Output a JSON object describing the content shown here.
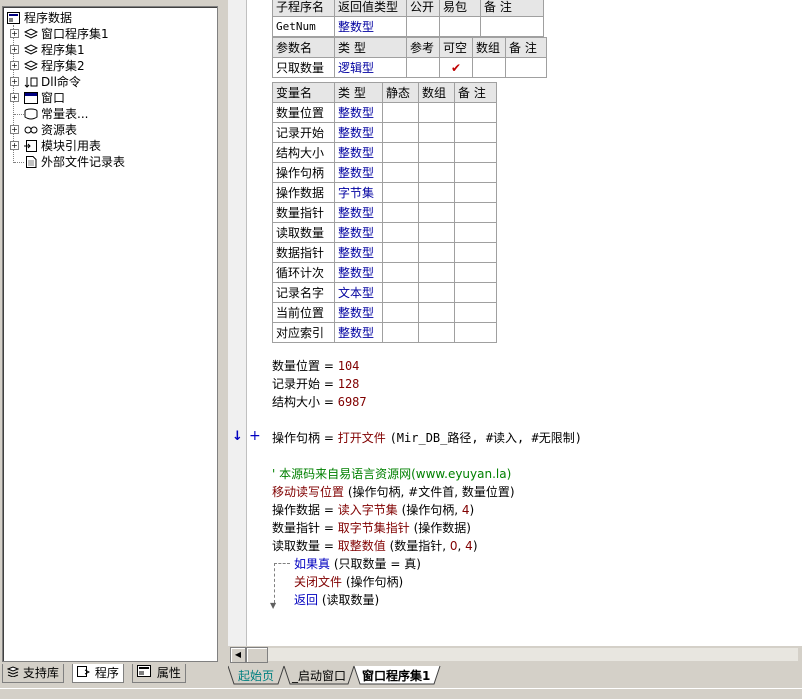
{
  "tree": {
    "root_label": "程序数据",
    "items": [
      {
        "label": "窗口程序集1",
        "icon": "module-icon",
        "expand": "+"
      },
      {
        "label": "程序集1",
        "icon": "module-icon",
        "expand": "+"
      },
      {
        "label": "程序集2",
        "icon": "module-icon",
        "expand": "+"
      },
      {
        "label": "Dll命令",
        "icon": "dll-icon",
        "expand": "+"
      },
      {
        "label": "窗口",
        "icon": "window-icon",
        "expand": "+"
      },
      {
        "label": "常量表...",
        "icon": "constant-icon",
        "expand": ""
      },
      {
        "label": "资源表",
        "icon": "resource-icon",
        "expand": "+"
      },
      {
        "label": "模块引用表",
        "icon": "module-ref-icon",
        "expand": "+"
      },
      {
        "label": "外部文件记录表",
        "icon": "file-icon",
        "expand": ""
      }
    ]
  },
  "left_tabs": [
    "支持库",
    "程序",
    "属性"
  ],
  "sub_header": {
    "cols": [
      "子程序名",
      "返回值类型",
      "公开",
      "易包",
      "备 注"
    ],
    "name": "GetNum",
    "return_type": "整数型"
  },
  "params": {
    "cols": [
      "参数名",
      "类 型",
      "参考",
      "可空",
      "数组",
      "备 注"
    ],
    "rows": [
      {
        "name": "只取数量",
        "type": "逻辑型",
        "nullable": "✔"
      }
    ]
  },
  "locals": {
    "cols": [
      "变量名",
      "类 型",
      "静态",
      "数组",
      "备 注"
    ],
    "rows": [
      {
        "name": "数量位置",
        "type": "整数型"
      },
      {
        "name": "记录开始",
        "type": "整数型"
      },
      {
        "name": "结构大小",
        "type": "整数型"
      },
      {
        "name": "操作句柄",
        "type": "整数型"
      },
      {
        "name": "操作数据",
        "type": "字节集"
      },
      {
        "name": "数量指针",
        "type": "整数型"
      },
      {
        "name": "读取数量",
        "type": "整数型"
      },
      {
        "name": "数据指针",
        "type": "整数型"
      },
      {
        "name": "循环计次",
        "type": "整数型"
      },
      {
        "name": "记录名字",
        "type": "文本型"
      },
      {
        "name": "当前位置",
        "type": "整数型"
      },
      {
        "name": "对应索引",
        "type": "整数型"
      }
    ]
  },
  "code": {
    "l1_var": "数量位置",
    "l1_val": "104",
    "l2_var": "记录开始",
    "l2_val": "128",
    "l3_var": "结构大小",
    "l3_val": "6987",
    "l4_var": "操作句柄",
    "l4_fn": "打开文件",
    "l4_args": "(Mir_DB_路径, #读入, #无限制)",
    "comment": "' 本源码来自易语言资源网(www.eyuyan.la)",
    "l6_fn": "移动读写位置",
    "l6_args": "(操作句柄, #文件首, 数量位置)",
    "l7_var": "操作数据",
    "l7_fn": "读入字节集",
    "l7_args_a": "(操作句柄, ",
    "l7_num": "4",
    "l7_args_b": ")",
    "l8_var": "数量指针",
    "l8_fn": "取字节集指针",
    "l8_args": "(操作数据)",
    "l9_var": "读取数量",
    "l9_fn": "取整数值",
    "l9_args_a": "(数量指针, ",
    "l9_num_a": "0",
    "l9_sep": ", ",
    "l9_num_b": "4",
    "l9_args_b": ")",
    "l10_kw": "如果真",
    "l10_args": "(只取数量 = 真)",
    "l11_fn": "关闭文件",
    "l11_args": "(操作句柄)",
    "l12_kw": "返回",
    "l12_args": "(读取数量)",
    "eq": "=",
    "marker_arrow": "↓",
    "marker_plus": "+"
  },
  "right_tabs": [
    "起始页",
    "_启动窗口",
    "窗口程序集1"
  ]
}
